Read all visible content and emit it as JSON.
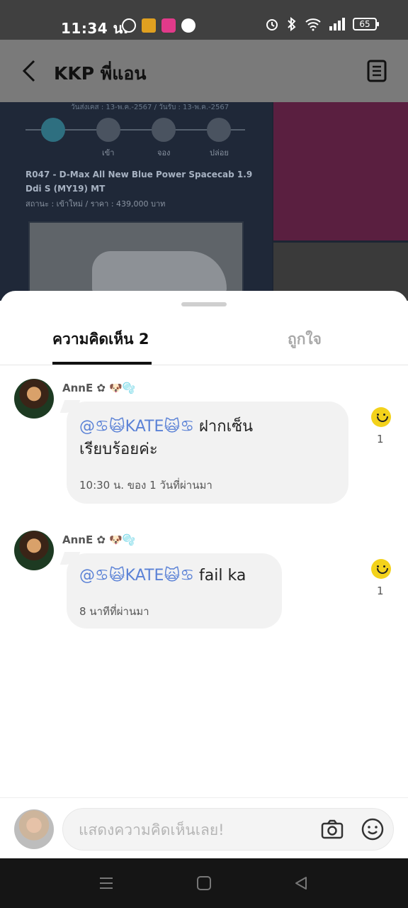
{
  "status_bar": {
    "time": "11:34 น.",
    "battery": "65"
  },
  "header": {
    "title": "KKP พี่แอน"
  },
  "background": {
    "date_line": "วันส่งเคส : 13-พ.ค.-2567 / วันรับ : 13-พ.ค.-2567",
    "steps": [
      "เข้า",
      "จอง",
      "ปล่อย"
    ],
    "model": "R047 - D-Max All New Blue Power Spacecab 1.9 Ddi S (MY19) MT",
    "status": "สถานะ : เข้าใหม่ / ราคา : 439,000 บาท"
  },
  "sheet": {
    "tabs": [
      {
        "label": "ความคิดเห็น 2",
        "active": true
      },
      {
        "label": "ถูกใจ",
        "active": false
      }
    ],
    "comments": [
      {
        "author": "AnnE ✿ 🐶🫧",
        "mention": "@♋🙀KATE🙀♋",
        "text_line1": " ฝากเซ็น",
        "text_line2": "เรียบร้อยค่ะ",
        "time": "10:30 น. ของ 1 วันที่ผ่านมา",
        "likes": "1"
      },
      {
        "author": "AnnE ✿ 🐶🫧",
        "mention": "@♋🙀KATE🙀♋",
        "text_line1": " fail ka",
        "time": "8 นาทีที่ผ่านมา",
        "likes": "1"
      }
    ]
  },
  "input": {
    "placeholder": "แสดงความคิดเห็นเลย!"
  }
}
